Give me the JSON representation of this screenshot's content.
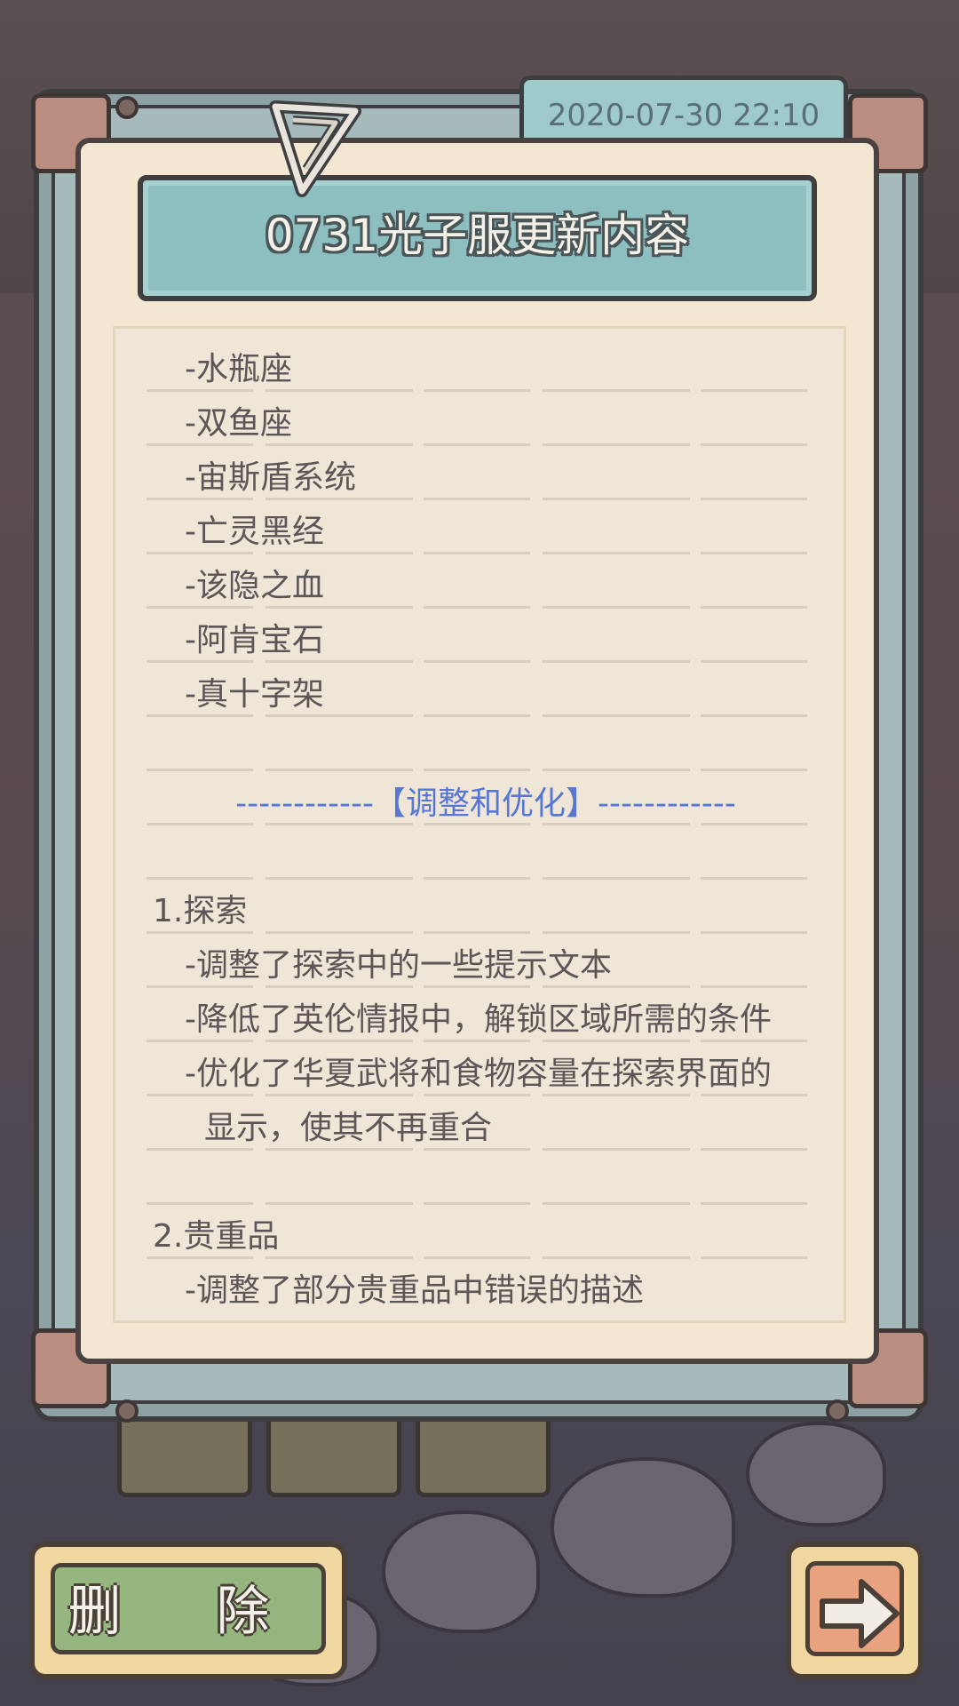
{
  "note": {
    "timestamp": "2020-07-30  22:10",
    "title": "0731光子服更新内容",
    "lines": [
      "-水瓶座",
      "-双鱼座",
      "-宙斯盾系统",
      "-亡灵黑经",
      "-该隐之血",
      "-阿肯宝石",
      "-真十字架"
    ],
    "section_header": "------------【调整和优化】------------",
    "groups": [
      {
        "heading": "1.探索",
        "items": [
          "-调整了探索中的一些提示文本",
          "-降低了英伦情报中，解锁区域所需的条件",
          "-优化了华夏武将和食物容量在探索界面的",
          "显示，使其不再重合"
        ]
      },
      {
        "heading": "2.贵重品",
        "items": [
          "-调整了部分贵重品中错误的描述"
        ]
      }
    ]
  },
  "buttons": {
    "delete_label": "删 除",
    "next_icon": "arrow-right-icon"
  },
  "colors": {
    "paper": "#f3e7d1",
    "banner": "#8ebfc0",
    "section_header": "#5877d2",
    "delete_button": "#95b77f",
    "next_button": "#e8a27f"
  }
}
